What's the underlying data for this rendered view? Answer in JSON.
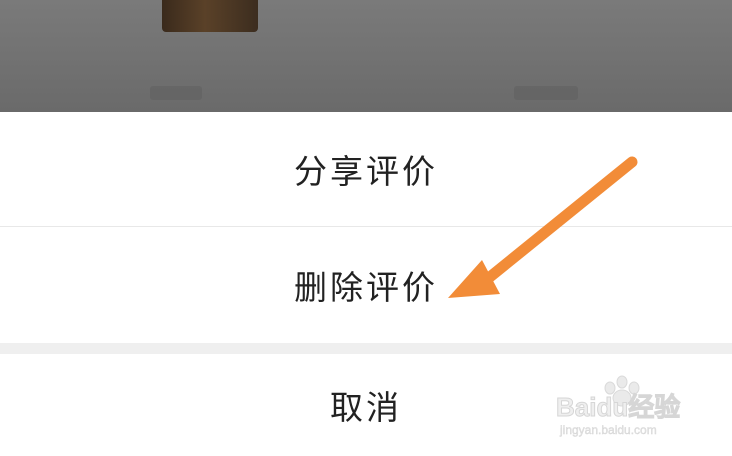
{
  "action_sheet": {
    "share_label": "分享评价",
    "delete_label": "删除评价",
    "cancel_label": "取消"
  },
  "annotation": {
    "arrow_color": "#f28c38",
    "points_to": "delete-review-item"
  },
  "watermark": {
    "brand": "Baidu经验",
    "url": "jingyan.baidu.com"
  },
  "colors": {
    "overlay": "#6e6e6e",
    "sheet_bg": "#ffffff",
    "text": "#222222"
  }
}
